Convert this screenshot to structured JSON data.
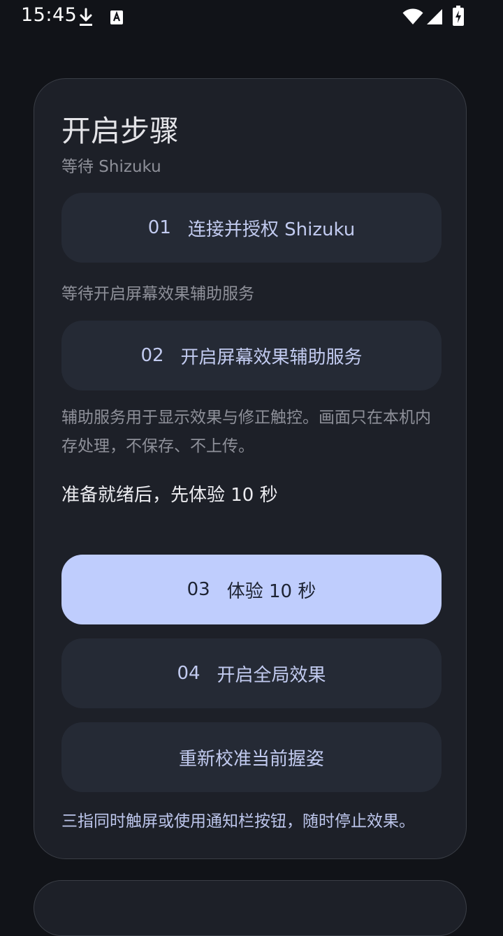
{
  "status_bar": {
    "time": "15:45",
    "icons": [
      "download-icon",
      "a-notification-icon",
      "wifi-icon",
      "signal-icon",
      "battery-charging-icon"
    ]
  },
  "card": {
    "title": "开启步骤",
    "subtitle": "等待 Shizuku",
    "step1": {
      "number": "01",
      "label": "连接并授权 Shizuku"
    },
    "step2_hint": "等待开启屏幕效果辅助服务",
    "step2": {
      "number": "02",
      "label": "开启屏幕效果辅助服务"
    },
    "privacy_note": "辅助服务用于显示效果与修正触控。画面只在本机内存处理，不保存、不上传。",
    "ready_text": "准备就绪后，先体验 10 秒",
    "step3": {
      "number": "03",
      "label": "体验 10 秒"
    },
    "step4": {
      "number": "04",
      "label": "开启全局效果"
    },
    "recalibrate_label": "重新校准当前握姿",
    "stop_hint": "三指同时触屏或使用通知栏按钮，随时停止效果。"
  },
  "colors": {
    "background": "#111318",
    "card": "#1d2028",
    "button": "#252a35",
    "primary_button": "#bfcdfd",
    "accent_text": "#c2cbf0"
  }
}
